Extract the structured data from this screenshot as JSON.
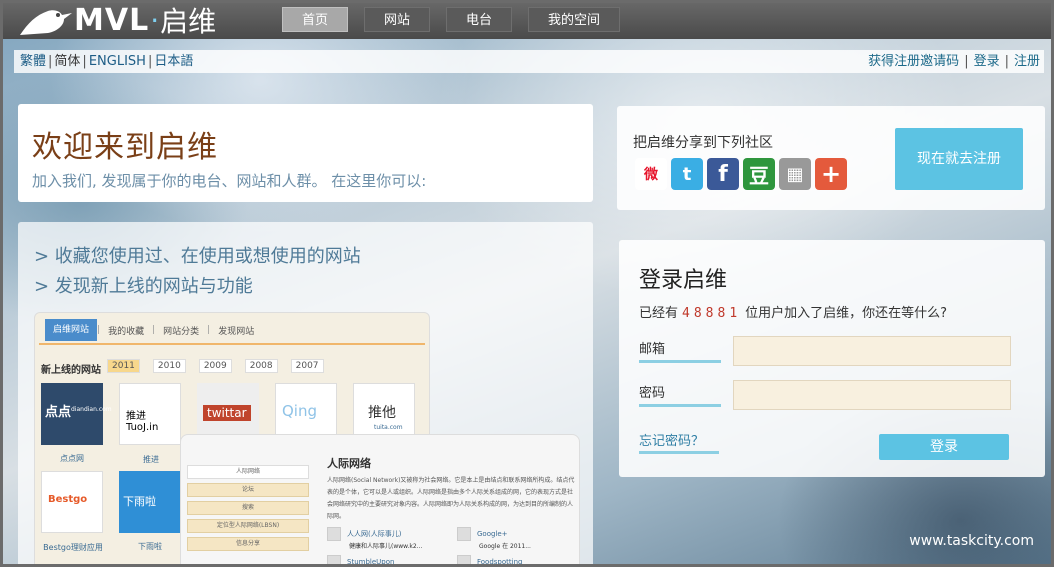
{
  "logo": {
    "brand": "MVL",
    "dot": "·",
    "cn": "启维"
  },
  "nav": [
    {
      "label": "首页",
      "active": true
    },
    {
      "label": "网站",
      "active": false
    },
    {
      "label": "电台",
      "active": false
    },
    {
      "label": "我的空间",
      "active": false
    }
  ],
  "langs": [
    "繁體",
    "简体",
    "ENGLISH",
    "日本語"
  ],
  "account_links": [
    "获得注册邀请码",
    "登录",
    "注册"
  ],
  "welcome": {
    "title": "欢迎来到启维",
    "subtitle": "加入我们, 发现属于你的电台、网站和人群。 在这里你可以:"
  },
  "features": [
    "> 收藏您使用过、在使用或想使用的网站",
    "> 发现新上线的网站与功能"
  ],
  "preview1": {
    "tabs": [
      "启维网站",
      "我的收藏",
      "网站分类",
      "发现网站"
    ],
    "heading": "新上线的网站",
    "years": [
      "2011",
      "2010",
      "2009",
      "2008",
      "2007"
    ],
    "thumbs": [
      {
        "text": "点点",
        "sub": "diandian.com",
        "label": "点点网"
      },
      {
        "text": "推进 TuoJ.in",
        "label": "推进"
      },
      {
        "text": "twittar"
      },
      {
        "text": "Qing"
      },
      {
        "text": "推他",
        "sub": "tuita.com"
      },
      {
        "text": "Bestgo",
        "label": "Bestgo理财应用"
      },
      {
        "text": "下雨啦",
        "label": "下雨啦"
      }
    ]
  },
  "preview2": {
    "side": [
      "人际网络",
      "论坛",
      "搜索",
      "定位型人际网络(LBSN)",
      "信息分享"
    ],
    "title": "人际网络",
    "desc": "人际网络(Social Network)又被称为社会网络。它是本上是由结点和联系网络所构成。结点代表的是个体，它可以是人或组织。人际网络是指由多个人际关系组成的网，它的表现方式是社会网络研究中的主要研究对象内容。人际网络即为人际关系构成的网，为达到目的所编制的人际网。",
    "items": [
      {
        "name": "人人网(人际事儿)",
        "sub": "健康和人际事儿(www.k2..."
      },
      {
        "name": "Google+",
        "sub": "Google 在 2011..."
      },
      {
        "name": "StumbleUpon"
      },
      {
        "name": "Foodspotting"
      }
    ]
  },
  "share": {
    "title": "把启维分享到下列社区",
    "icons": [
      "weibo-icon",
      "twitter-icon",
      "facebook-icon",
      "douban-icon",
      "grid-icon",
      "plus-icon"
    ],
    "register": "现在就去注册"
  },
  "login": {
    "title": "登录启维",
    "stat_pre": "已经有",
    "stat_num": "48881",
    "stat_post": "位用户加入了启维，你还在等什么?",
    "email_label": "邮箱",
    "password_label": "密码",
    "email_value": "",
    "password_value": "",
    "forgot": "忘记密码？",
    "submit": "登录"
  },
  "watermark": "www.taskcity.com",
  "colors": {
    "accent": "#5cc3e3",
    "title": "#7a3f17",
    "link": "#1d5d86"
  }
}
